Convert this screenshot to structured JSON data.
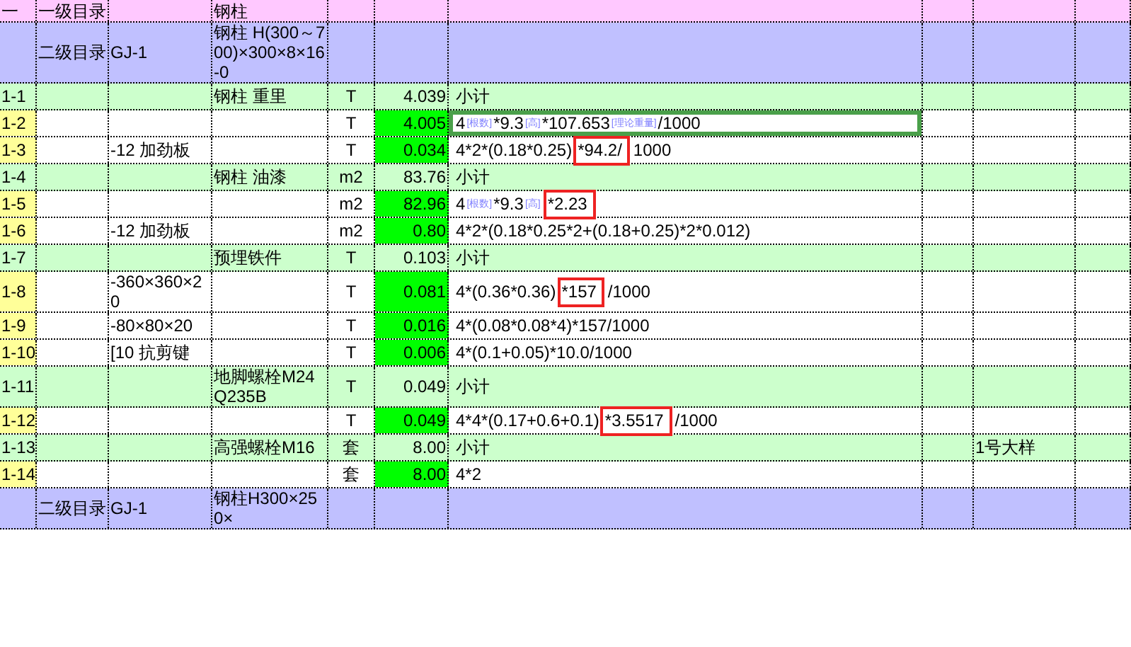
{
  "rows": [
    {
      "kind": "heading1",
      "number": "一",
      "catalog": "一级目录",
      "name": "钢柱"
    },
    {
      "kind": "heading2",
      "catalog": "二级目录",
      "code": "GJ-1",
      "name": "钢柱 H(300～700)×300×8×16-0"
    },
    {
      "kind": "subtotal",
      "number": "1-1",
      "name": "钢柱 重里",
      "unit": "T",
      "quantity": "4.039",
      "formula": [
        {
          "kind": "text",
          "text": "小计"
        }
      ]
    },
    {
      "kind": "detail",
      "number": "1-2",
      "unit": "T",
      "quantity": "4.005",
      "selected": true,
      "formula": [
        {
          "kind": "text",
          "text": "4"
        },
        {
          "kind": "tag",
          "text": "[根数]"
        },
        {
          "kind": "text",
          "text": "*9.3"
        },
        {
          "kind": "tag",
          "text": "[高]"
        },
        {
          "kind": "text",
          "text": "*107.653"
        },
        {
          "kind": "tag",
          "text": "[理论重量]"
        },
        {
          "kind": "text",
          "text": "/1000"
        }
      ]
    },
    {
      "kind": "detail",
      "number": "1-3",
      "code": "-12 加劲板",
      "unit": "T",
      "quantity": "0.034",
      "selected": false,
      "formula": [
        {
          "kind": "text",
          "text": "4*2*(0.18*0.25)"
        },
        {
          "kind": "mark",
          "text": "*94.2/"
        },
        {
          "kind": "text",
          "text": "1000"
        }
      ]
    },
    {
      "kind": "subtotal",
      "number": "1-4",
      "name": "钢柱 油漆",
      "unit": "m2",
      "quantity": "83.76",
      "formula": [
        {
          "kind": "text",
          "text": "小计"
        }
      ]
    },
    {
      "kind": "detail",
      "number": "1-5",
      "unit": "m2",
      "quantity": "82.96",
      "selected": false,
      "formula": [
        {
          "kind": "text",
          "text": "4"
        },
        {
          "kind": "tag",
          "text": "[根数]"
        },
        {
          "kind": "text",
          "text": "*9.3"
        },
        {
          "kind": "tag",
          "text": "[高]"
        },
        {
          "kind": "mark",
          "text": "*2.23"
        }
      ]
    },
    {
      "kind": "detail",
      "number": "1-6",
      "code": "-12 加劲板",
      "unit": "m2",
      "quantity": "0.80",
      "selected": false,
      "formula": [
        {
          "kind": "text",
          "text": "4*2*(0.18*0.25*2+(0.18+0.25)*2*0.012)"
        }
      ]
    },
    {
      "kind": "subtotal",
      "number": "1-7",
      "name": "预埋铁件",
      "unit": "T",
      "quantity": "0.103",
      "formula": [
        {
          "kind": "text",
          "text": "小计"
        }
      ]
    },
    {
      "kind": "detail",
      "number": "1-8",
      "code": "-360×360×20",
      "unit": "T",
      "quantity": "0.081",
      "selected": false,
      "formula": [
        {
          "kind": "text",
          "text": "4*(0.36*0.36)"
        },
        {
          "kind": "mark",
          "text": "*157"
        },
        {
          "kind": "text",
          "text": "/1000"
        }
      ]
    },
    {
      "kind": "detail",
      "number": "1-9",
      "code": "-80×80×20",
      "unit": "T",
      "quantity": "0.016",
      "selected": false,
      "formula": [
        {
          "kind": "text",
          "text": "4*(0.08*0.08*4)*157/1000"
        }
      ]
    },
    {
      "kind": "detail",
      "number": "1-10",
      "code": "[10 抗剪键",
      "unit": "T",
      "quantity": "0.006",
      "selected": false,
      "formula": [
        {
          "kind": "text",
          "text": "4*(0.1+0.05)*10.0/1000"
        }
      ]
    },
    {
      "kind": "subtotal",
      "number": "1-11",
      "name": "地脚螺栓M24 Q235B",
      "unit": "T",
      "quantity": "0.049",
      "formula": [
        {
          "kind": "text",
          "text": "小计"
        }
      ]
    },
    {
      "kind": "detail",
      "number": "1-12",
      "unit": "T",
      "quantity": "0.049",
      "selected": false,
      "formula": [
        {
          "kind": "text",
          "text": "4*4*(0.17+0.6+0.1)"
        },
        {
          "kind": "mark",
          "text": "*3.5517"
        },
        {
          "kind": "text",
          "text": "/1000"
        }
      ]
    },
    {
      "kind": "subtotal",
      "number": "1-13",
      "name": "高强螺栓M16",
      "unit": "套",
      "quantity": "8.00",
      "remark": "1号大样",
      "formula": [
        {
          "kind": "text",
          "text": "小计"
        }
      ]
    },
    {
      "kind": "detail",
      "number": "1-14",
      "unit": "套",
      "quantity": "8.00",
      "selected": false,
      "formula": [
        {
          "kind": "text",
          "text": "4*2"
        }
      ]
    },
    {
      "kind": "heading2",
      "catalog": "二级目录",
      "code": "GJ-1",
      "name": "钢柱H300×250×"
    }
  ]
}
